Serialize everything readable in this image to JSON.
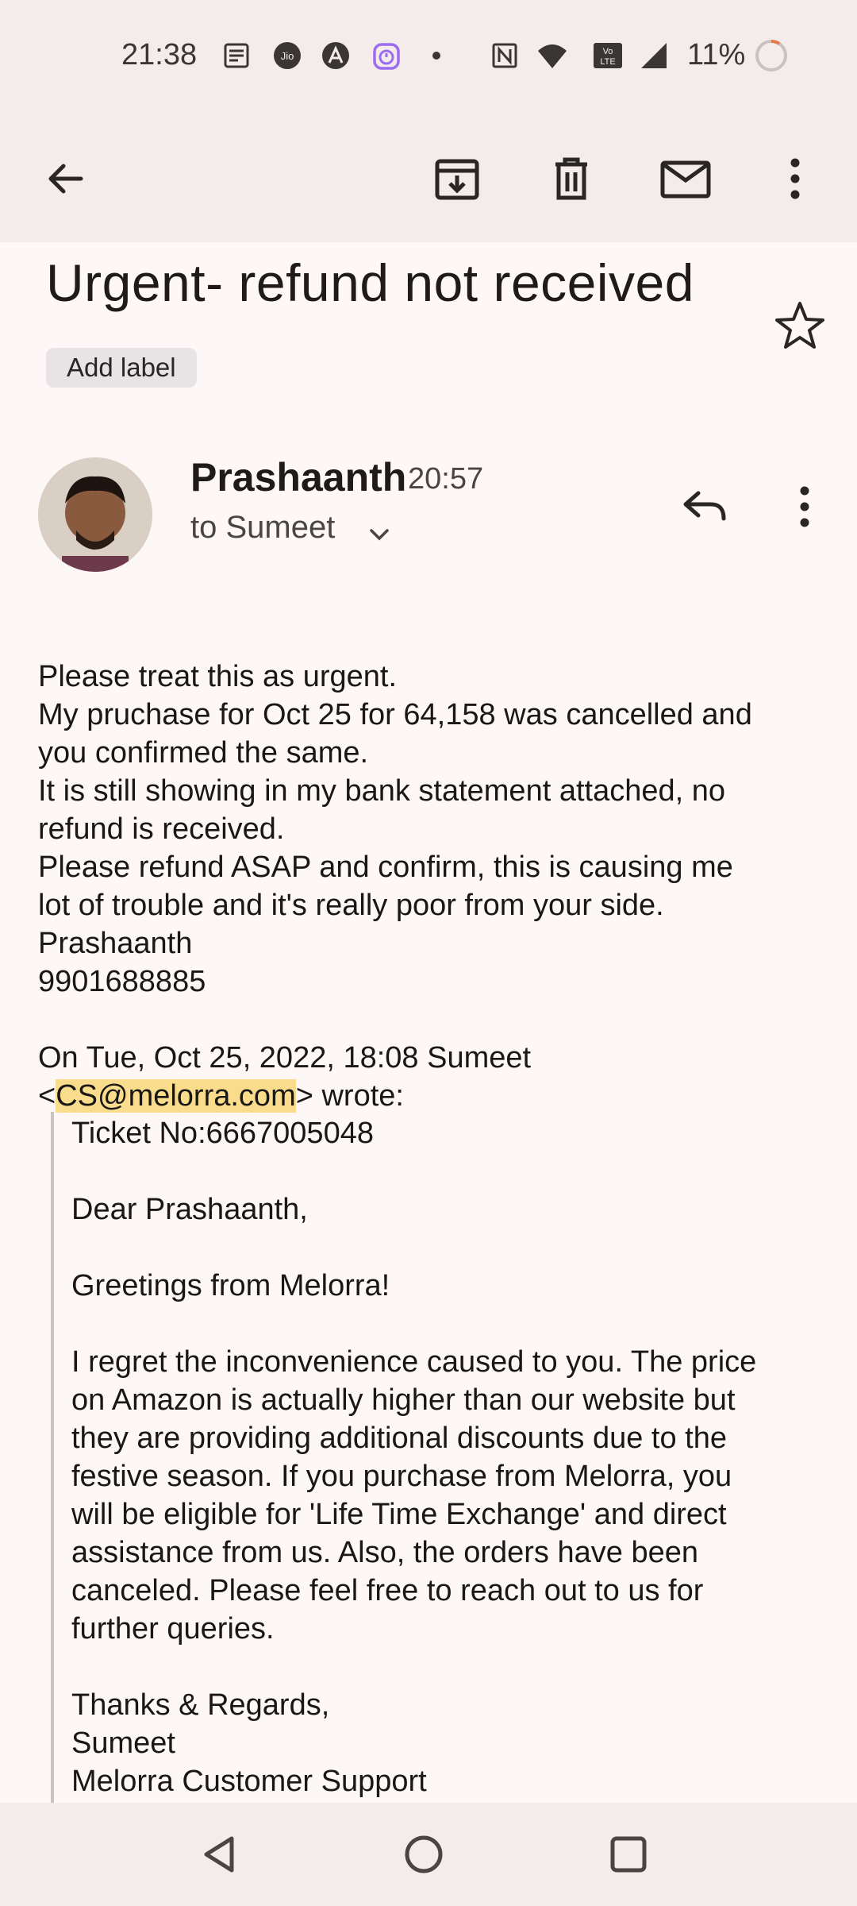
{
  "status_bar": {
    "time": "21:38",
    "battery": "11%",
    "icons": [
      "news-icon",
      "jio-icon",
      "a-icon",
      "timer-icon",
      "dot-icon",
      "nfc-icon",
      "wifi-icon",
      "volte-icon",
      "signal-icon",
      "battery-icon"
    ]
  },
  "app_bar": {
    "icons": [
      "back-arrow-icon",
      "archive-icon",
      "delete-icon",
      "mark-unread-icon",
      "more-vert-icon"
    ]
  },
  "email": {
    "subject": "Urgent- refund not received",
    "label_chip": "Add label",
    "sender": "Prashaanth",
    "time": "20:57",
    "recipient": "to Sumeet",
    "body_lines": [
      "Please treat this as urgent.",
      "My pruchase for Oct 25 for 64,158 was cancelled and",
      "you confirmed the same.",
      "It is still showing in my bank statement attached, no",
      "refund is received.",
      "Please refund ASAP and confirm, this is causing me",
      "lot of trouble and it's really poor from your side.",
      "Prashaanth",
      "9901688885"
    ],
    "quote_header_line1": "On Tue, Oct 25, 2022, 18:08 Sumeet",
    "quote_email_prefix": "<",
    "quote_email": "CS@melorra.com",
    "quote_email_suffix": "> wrote:",
    "quoted_lines": [
      "Ticket No:6667005048",
      "",
      "Dear Prashaanth,",
      "",
      "Greetings from Melorra!",
      "",
      "I regret the inconvenience caused to you. The price",
      "on Amazon is actually higher than our website but",
      "they are providing additional discounts due to the",
      "festive season. If you purchase from Melorra, you",
      "will be eligible for 'Life Time Exchange' and direct",
      "assistance from us. Also, the orders have been",
      "canceled. Please feel free to reach out to us for",
      "further queries.",
      "",
      "Thanks & Regards,",
      "Sumeet",
      "Melorra Customer Support"
    ]
  },
  "nav_bar": {
    "icons": [
      "back-triangle-icon",
      "home-circle-icon",
      "recents-square-icon"
    ]
  },
  "colors": {
    "background": "#fdf8f7",
    "bar": "#f3ecea",
    "highlight": "#f9dd8c",
    "accent_timer": "#9b6cf0"
  }
}
